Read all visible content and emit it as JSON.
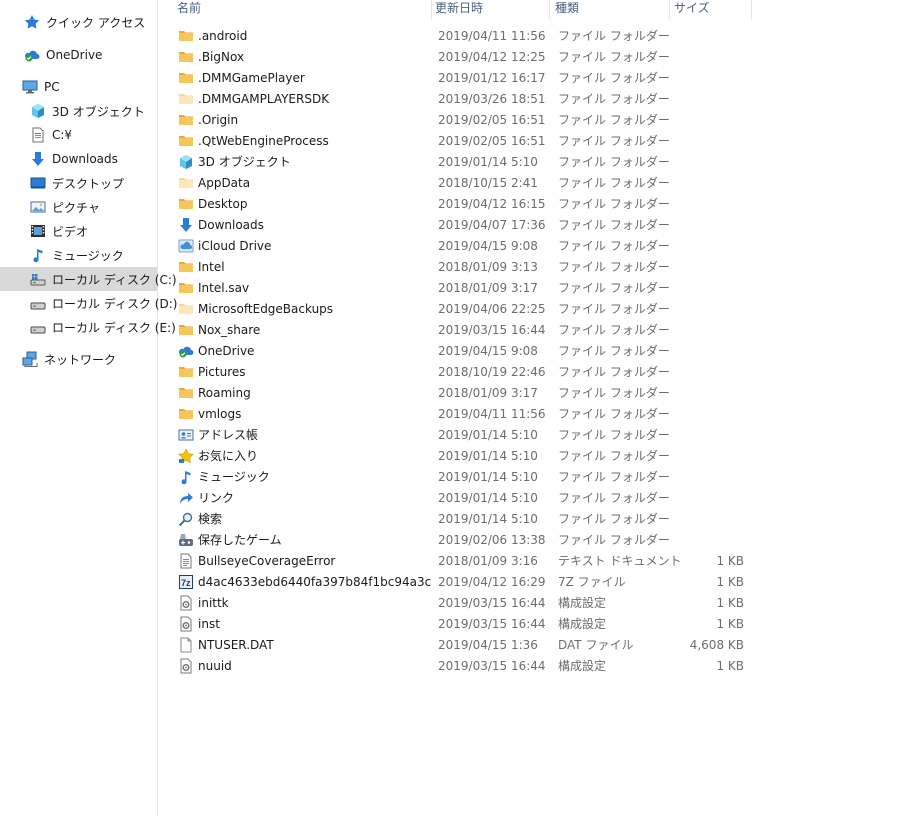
{
  "colors": {
    "folder": "#f7c65a",
    "folder_dark": "#e8a93a",
    "selection": "#d9d9d9",
    "header_text": "#4d6082",
    "accent_blue": "#2b7cd3"
  },
  "nav": {
    "items": [
      {
        "label": "クイック アクセス",
        "icon": "star-icon"
      },
      {
        "label": "OneDrive",
        "icon": "onedrive-icon"
      },
      {
        "label": "PC",
        "icon": "pc-icon"
      },
      {
        "label": "3D オブジェクト",
        "icon": "3d-objects-icon"
      },
      {
        "label": "C:¥",
        "icon": "document-icon"
      },
      {
        "label": "Downloads",
        "icon": "download-arrow-icon"
      },
      {
        "label": "デスクトップ",
        "icon": "desktop-icon"
      },
      {
        "label": "ピクチャ",
        "icon": "pictures-icon"
      },
      {
        "label": "ビデオ",
        "icon": "video-icon"
      },
      {
        "label": "ミュージック",
        "icon": "music-icon"
      },
      {
        "label": "ローカル ディスク (C:)",
        "icon": "drive-c-icon",
        "selected": true
      },
      {
        "label": "ローカル ディスク (D:)",
        "icon": "drive-icon"
      },
      {
        "label": "ローカル ディスク (E:)",
        "icon": "drive-icon"
      },
      {
        "label": "ネットワーク",
        "icon": "network-icon"
      }
    ]
  },
  "columns": {
    "name": "名前",
    "date": "更新日時",
    "type": "種類",
    "size": "サイズ"
  },
  "files": [
    {
      "name": ".android",
      "date": "2019/04/11 11:56",
      "type": "ファイル フォルダー",
      "size": "",
      "icon": "folder-icon"
    },
    {
      "name": ".BigNox",
      "date": "2019/04/12 12:25",
      "type": "ファイル フォルダー",
      "size": "",
      "icon": "folder-icon"
    },
    {
      "name": ".DMMGamePlayer",
      "date": "2019/01/12 16:17",
      "type": "ファイル フォルダー",
      "size": "",
      "icon": "folder-icon"
    },
    {
      "name": ".DMMGAMPLAYERSDK",
      "date": "2019/03/26 18:51",
      "type": "ファイル フォルダー",
      "size": "",
      "icon": "folder-light-icon"
    },
    {
      "name": ".Origin",
      "date": "2019/02/05 16:51",
      "type": "ファイル フォルダー",
      "size": "",
      "icon": "folder-icon"
    },
    {
      "name": ".QtWebEngineProcess",
      "date": "2019/02/05 16:51",
      "type": "ファイル フォルダー",
      "size": "",
      "icon": "folder-icon"
    },
    {
      "name": "3D オブジェクト",
      "date": "2019/01/14 5:10",
      "type": "ファイル フォルダー",
      "size": "",
      "icon": "3d-objects-icon"
    },
    {
      "name": "AppData",
      "date": "2018/10/15 2:41",
      "type": "ファイル フォルダー",
      "size": "",
      "icon": "folder-light-icon"
    },
    {
      "name": "Desktop",
      "date": "2019/04/12 16:15",
      "type": "ファイル フォルダー",
      "size": "",
      "icon": "folder-icon"
    },
    {
      "name": "Downloads",
      "date": "2019/04/07 17:36",
      "type": "ファイル フォルダー",
      "size": "",
      "icon": "download-arrow-icon"
    },
    {
      "name": "iCloud Drive",
      "date": "2019/04/15 9:08",
      "type": "ファイル フォルダー",
      "size": "",
      "icon": "icloud-icon"
    },
    {
      "name": "Intel",
      "date": "2018/01/09 3:13",
      "type": "ファイル フォルダー",
      "size": "",
      "icon": "folder-icon"
    },
    {
      "name": "Intel.sav",
      "date": "2018/01/09 3:17",
      "type": "ファイル フォルダー",
      "size": "",
      "icon": "folder-icon"
    },
    {
      "name": "MicrosoftEdgeBackups",
      "date": "2019/04/06 22:25",
      "type": "ファイル フォルダー",
      "size": "",
      "icon": "folder-light-icon"
    },
    {
      "name": "Nox_share",
      "date": "2019/03/15 16:44",
      "type": "ファイル フォルダー",
      "size": "",
      "icon": "folder-icon"
    },
    {
      "name": "OneDrive",
      "date": "2019/04/15 9:08",
      "type": "ファイル フォルダー",
      "size": "",
      "icon": "onedrive-icon"
    },
    {
      "name": "Pictures",
      "date": "2018/10/19 22:46",
      "type": "ファイル フォルダー",
      "size": "",
      "icon": "folder-icon"
    },
    {
      "name": "Roaming",
      "date": "2018/01/09 3:17",
      "type": "ファイル フォルダー",
      "size": "",
      "icon": "folder-icon"
    },
    {
      "name": "vmlogs",
      "date": "2019/04/11 11:56",
      "type": "ファイル フォルダー",
      "size": "",
      "icon": "folder-icon"
    },
    {
      "name": "アドレス帳",
      "date": "2019/01/14 5:10",
      "type": "ファイル フォルダー",
      "size": "",
      "icon": "contacts-icon"
    },
    {
      "name": "お気に入り",
      "date": "2019/01/14 5:10",
      "type": "ファイル フォルダー",
      "size": "",
      "icon": "favorites-star-icon"
    },
    {
      "name": "ミュージック",
      "date": "2019/01/14 5:10",
      "type": "ファイル フォルダー",
      "size": "",
      "icon": "music-icon"
    },
    {
      "name": "リンク",
      "date": "2019/01/14 5:10",
      "type": "ファイル フォルダー",
      "size": "",
      "icon": "link-arrow-icon"
    },
    {
      "name": "検索",
      "date": "2019/01/14 5:10",
      "type": "ファイル フォルダー",
      "size": "",
      "icon": "search-icon"
    },
    {
      "name": "保存したゲーム",
      "date": "2019/02/06 13:38",
      "type": "ファイル フォルダー",
      "size": "",
      "icon": "saved-games-icon"
    },
    {
      "name": "BullseyeCoverageError",
      "date": "2018/01/09 3:16",
      "type": "テキスト ドキュメント",
      "size": "1 KB",
      "icon": "text-file-icon"
    },
    {
      "name": "d4ac4633ebd6440fa397b84f1bc94a3c",
      "date": "2019/04/12 16:29",
      "type": "7Z ファイル",
      "size": "1 KB",
      "icon": "archive-7z-icon"
    },
    {
      "name": "inittk",
      "date": "2019/03/15 16:44",
      "type": "構成設定",
      "size": "1 KB",
      "icon": "config-file-icon"
    },
    {
      "name": "inst",
      "date": "2019/03/15 16:44",
      "type": "構成設定",
      "size": "1 KB",
      "icon": "config-file-icon"
    },
    {
      "name": "NTUSER.DAT",
      "date": "2019/04/15 1:36",
      "type": "DAT ファイル",
      "size": "4,608 KB",
      "icon": "blank-file-icon"
    },
    {
      "name": "nuuid",
      "date": "2019/03/15 16:44",
      "type": "構成設定",
      "size": "1 KB",
      "icon": "config-file-icon"
    }
  ]
}
